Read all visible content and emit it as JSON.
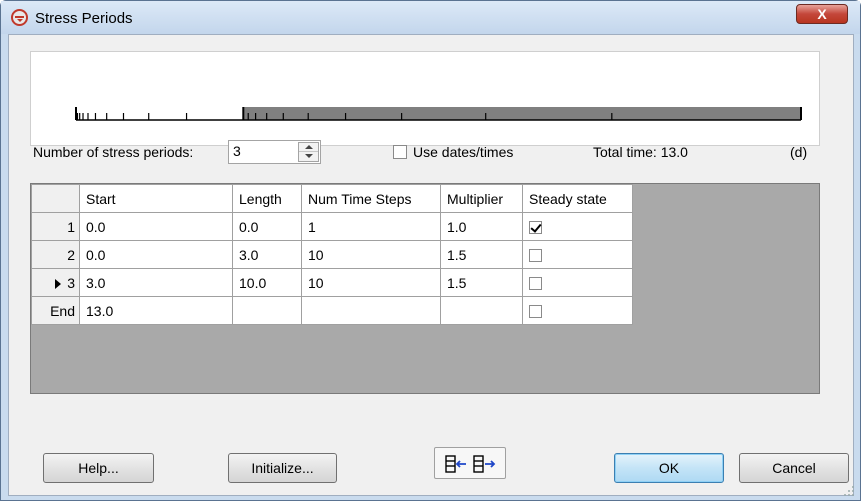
{
  "window": {
    "title": "Stress Periods",
    "close_label": "X"
  },
  "timeline": {
    "total_time": 13.0,
    "periods": [
      {
        "start": 0.0,
        "length": 0.0,
        "steps": 1,
        "multiplier": 1.0
      },
      {
        "start": 0.0,
        "length": 3.0,
        "steps": 10,
        "multiplier": 1.5
      },
      {
        "start": 3.0,
        "length": 10.0,
        "steps": 10,
        "multiplier": 1.5
      }
    ],
    "selected_period_index": 2,
    "selected_fill": "#808080"
  },
  "controls": {
    "num_periods_label": "Number of stress periods:",
    "num_periods_value": "3",
    "use_dates_label": "Use dates/times",
    "use_dates_checked": false,
    "total_time_label": "Total time: 13.0",
    "time_unit_label": "(d)"
  },
  "grid": {
    "columns": [
      "Start",
      "Length",
      "Num Time Steps",
      "Multiplier",
      "Steady state"
    ],
    "rows": [
      {
        "id": "1",
        "start": "0.0",
        "length": "0.0",
        "steps": "1",
        "multiplier": "1.0",
        "steady": true,
        "current": false
      },
      {
        "id": "2",
        "start": "0.0",
        "length": "3.0",
        "steps": "10",
        "multiplier": "1.5",
        "steady": false,
        "current": false
      },
      {
        "id": "3",
        "start": "3.0",
        "length": "10.0",
        "steps": "10",
        "multiplier": "1.5",
        "steady": false,
        "current": true
      },
      {
        "id": "End",
        "start": "13.0",
        "length": "",
        "steps": "",
        "multiplier": "",
        "steady": false,
        "current": false
      }
    ]
  },
  "buttons": {
    "help": "Help...",
    "initialize": "Initialize...",
    "insert_delete_icons": [
      "insert-row-icon",
      "delete-row-icon"
    ],
    "ok": "OK",
    "cancel": "Cancel"
  },
  "colors": {
    "accent": "#3c7fb1",
    "title_icon": "#c0392b",
    "close": "#c4473a"
  }
}
